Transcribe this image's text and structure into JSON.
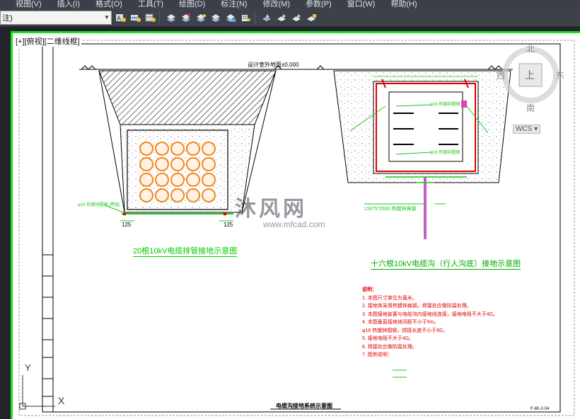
{
  "menubar": {
    "items": [
      "视图(V)",
      "插入(I)",
      "格式(O)",
      "工具(T)",
      "绘图(D)",
      "标注(N)",
      "修改(M)",
      "参数(P)",
      "窗口(W)",
      "帮助(H)"
    ]
  },
  "toolbar": {
    "layer_value": "注)",
    "icons": [
      "text-style-icon",
      "dim-style-icon",
      "table-style-icon",
      "mleader-style-icon",
      "layer-prev-icon",
      "layer-match-icon",
      "layer-iso-icon",
      "layer-unisolate-icon",
      "layer-freeze-icon",
      "layer-off-icon",
      "layer-lock-icon",
      "layer-walk-icon",
      "layer-merge-icon",
      "layer-delete-icon"
    ]
  },
  "viewport": {
    "label": "[+][俯视][二维线框]",
    "nav_cube": {
      "north": "北",
      "east": "东",
      "south": "南",
      "west": "西",
      "face": "上"
    },
    "wcs_label": "WCS",
    "ucs_y": "Y",
    "ucs_x": "X",
    "accent_color": "#1fe01f"
  },
  "watermark": {
    "text": "沐风网",
    "url": "www.mfcad.com"
  },
  "drawing": {
    "ground_label": "设计室外地面±0.000",
    "left_title": "20根10kV电缆排管接地示意图",
    "right_title": "十六根10kV电缆沟（行人沟底）接地示意图",
    "dim_left": "125",
    "dim_right": "125",
    "left_annotation": "φ16 热镀锌圆钢 (焊接)",
    "right_annot_1": "φ16 热镀锌圆钢",
    "right_annot_2": "φ16 热镀锌圆钢",
    "rod_label": "L50*5*2500 热镀锌角钢",
    "notes_title": "说明：",
    "notes": [
      "1. 本图尺寸单位为毫米。",
      "2. 接地体采用热镀锌扁钢，焊接处应做防腐处理。",
      "3. 本图接地装置与电缆沟内接地线连接，接地电阻不大于4Ω。",
      "4. 本图垂直接地体间距不小于5m。",
      "φ16 热镀锌圆钢，焊接长度不小于6D。",
      "5. 接地电阻不大于4Ω。",
      "6. 焊接处应做防腐处理。",
      "7. 图例说明："
    ],
    "drawing_title": "电缆沟接地系统示意图",
    "drawing_no": "F-80-2-04"
  }
}
